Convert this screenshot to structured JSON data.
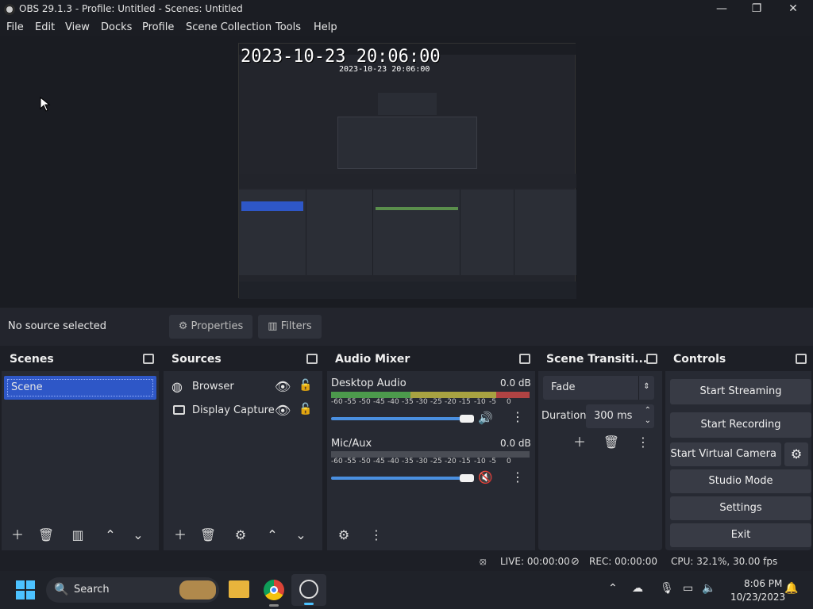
{
  "title": "OBS 29.1.3 - Profile: Untitled - Scenes: Untitled",
  "window_controls": {
    "minimize": "—",
    "maximize": "❐",
    "close": "✕"
  },
  "menu": [
    "File",
    "Edit",
    "View",
    "Docks",
    "Profile",
    "Scene Collection",
    "Tools",
    "Help"
  ],
  "preview": {
    "timestamp": "2023-10-23 20:06:00",
    "inner_timestamp": "2023-10-23 20:06:00"
  },
  "context_bar": {
    "no_source": "No source selected",
    "properties": "Properties",
    "filters": "Filters"
  },
  "scenes": {
    "title": "Scenes",
    "items": [
      "Scene"
    ]
  },
  "sources": {
    "title": "Sources",
    "items": [
      "Browser",
      "Display Capture"
    ]
  },
  "audio": {
    "title": "Audio Mixer",
    "channels": [
      {
        "name": "Desktop Audio",
        "db": "0.0 dB",
        "muted": false
      },
      {
        "name": "Mic/Aux",
        "db": "0.0 dB",
        "muted": true
      }
    ],
    "ticks": [
      "-60",
      "-55",
      "-50",
      "-45",
      "-40",
      "-35",
      "-30",
      "-25",
      "-20",
      "-15",
      "-10",
      "-5",
      "0"
    ]
  },
  "transitions": {
    "title": "Scene Transiti...",
    "type": "Fade",
    "duration_label": "Duration",
    "duration_value": "300 ms"
  },
  "controls": {
    "title": "Controls",
    "start_streaming": "Start Streaming",
    "start_recording": "Start Recording",
    "start_virtual_camera": "Start Virtual Camera",
    "studio_mode": "Studio Mode",
    "settings": "Settings",
    "exit": "Exit"
  },
  "status": {
    "live": "LIVE: 00:00:00",
    "rec": "REC: 00:00:00",
    "cpu": "CPU: 32.1%, 30.00 fps"
  },
  "taskbar": {
    "search": "Search",
    "time": "8:06 PM",
    "date": "10/23/2023"
  },
  "colors": {
    "accent": "#4a8fe0",
    "selection": "#2e57c7",
    "meter_green": "#4c9a4c",
    "meter_yellow": "#a8a241",
    "meter_red": "#b04343",
    "muted_red": "#c83a3a"
  }
}
